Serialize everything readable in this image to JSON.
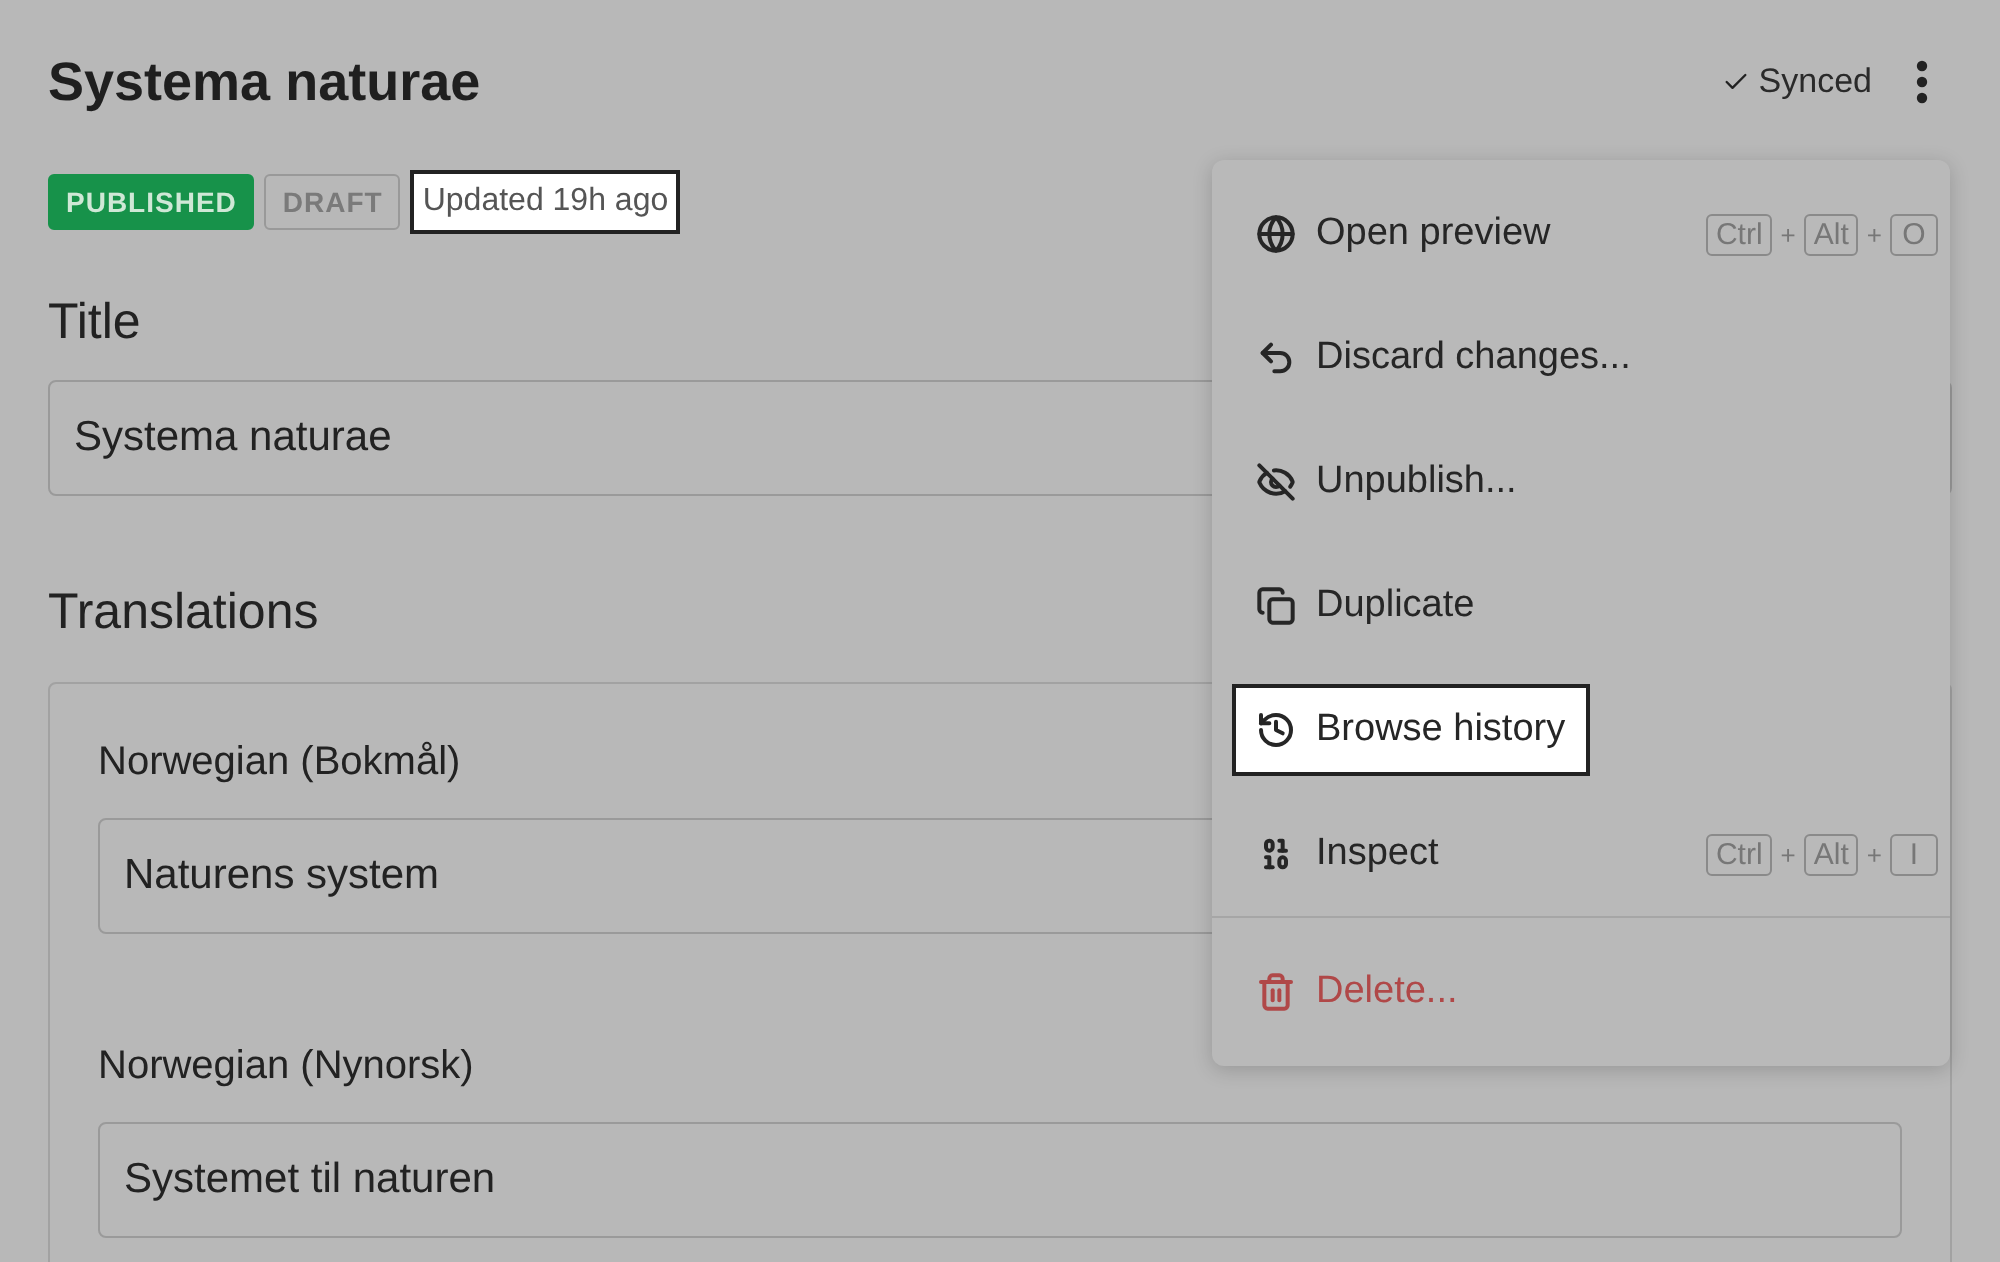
{
  "header": {
    "title": "Systema naturae",
    "sync_status": "Synced"
  },
  "badges": [
    {
      "label": "PUBLISHED",
      "kind": "published"
    },
    {
      "label": "DRAFT",
      "kind": "draft"
    }
  ],
  "updated": {
    "text": "Updated 19h ago",
    "highlighted": true
  },
  "title_field": {
    "label": "Title",
    "value": "Systema naturae"
  },
  "translations": {
    "heading": "Translations",
    "fields": [
      {
        "label": "Norwegian (Bokmål)",
        "value": "Naturens system"
      },
      {
        "label": "Norwegian (Nynorsk)",
        "value": "Systemet til naturen"
      }
    ]
  },
  "menu": {
    "items": [
      {
        "label": "Open preview",
        "kind": "normal",
        "highlighted": false,
        "shortcut": {
          "keys": [
            "Ctrl",
            "Alt",
            "O"
          ],
          "joiner": "+"
        }
      },
      {
        "label": "Discard changes...",
        "kind": "normal",
        "highlighted": false
      },
      {
        "label": "Unpublish...",
        "kind": "normal",
        "highlighted": false
      },
      {
        "label": "Duplicate",
        "kind": "normal",
        "highlighted": false
      },
      {
        "label": "Browse history",
        "kind": "normal",
        "highlighted": true
      },
      {
        "label": "Inspect",
        "kind": "normal",
        "highlighted": false,
        "shortcut": {
          "keys": [
            "Ctrl",
            "Alt",
            "I"
          ],
          "joiner": "+"
        }
      },
      {
        "label": "Delete...",
        "kind": "danger",
        "highlighted": false
      }
    ]
  }
}
